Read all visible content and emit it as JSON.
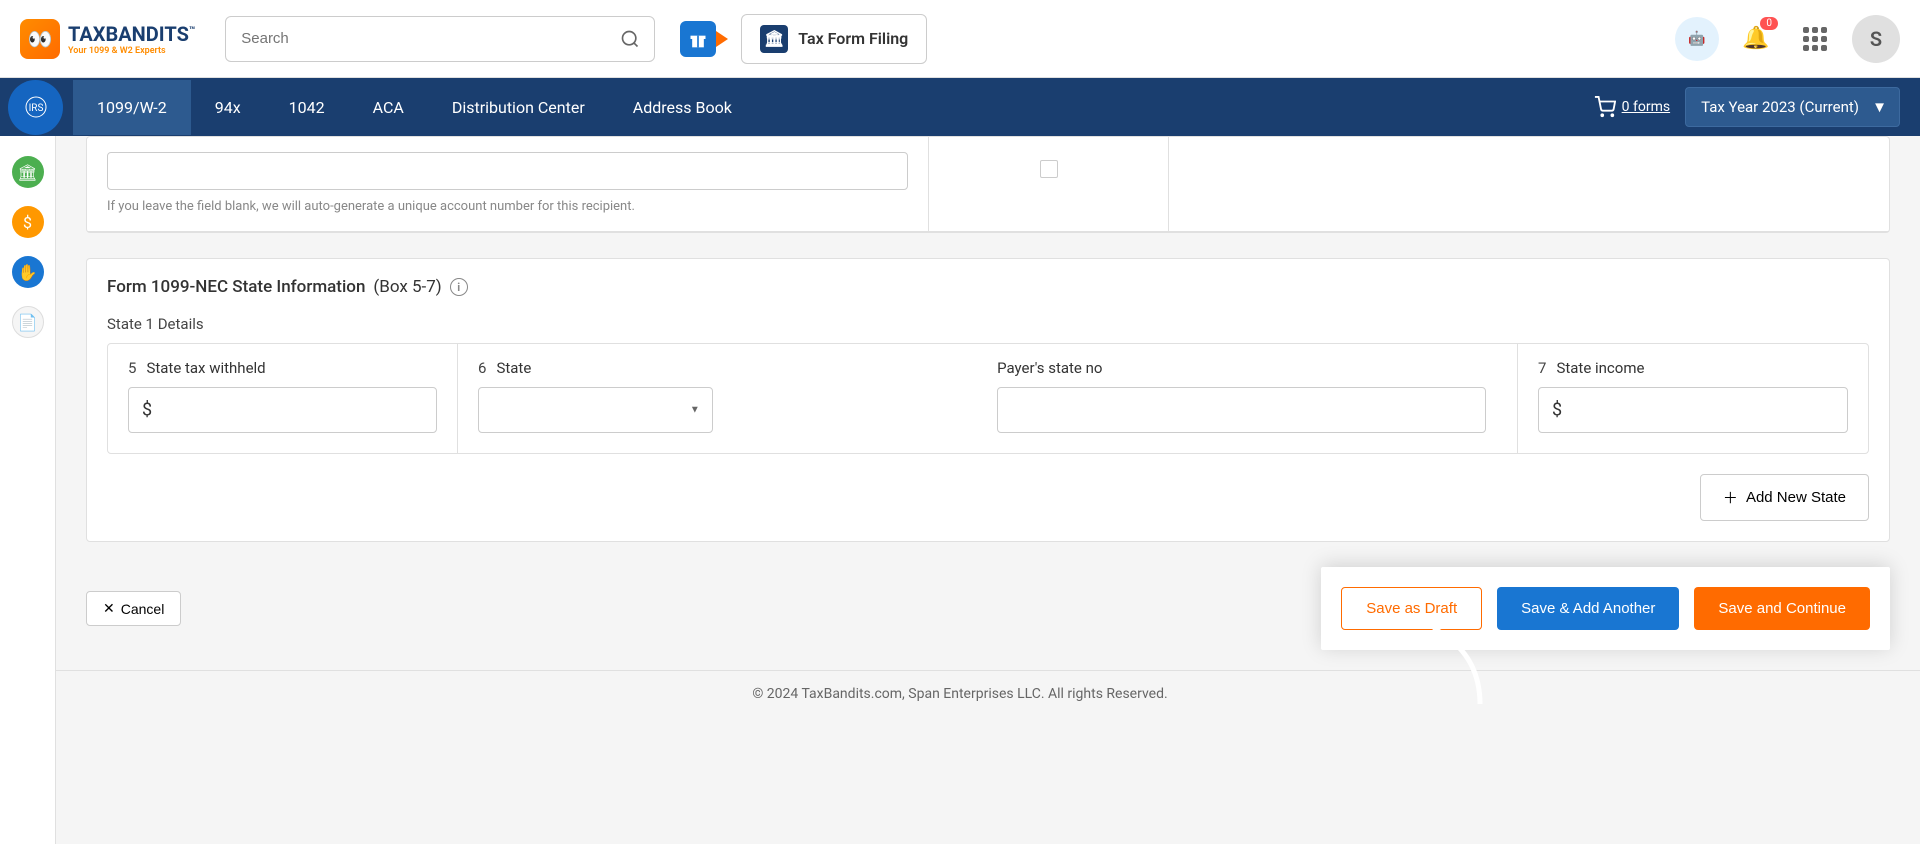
{
  "header": {
    "logo_text": "TAXBANDITS",
    "logo_subtitle": "Your 1099 & W2 Experts",
    "logo_sup": "™",
    "search_placeholder": "Search",
    "tax_filing_label": "Tax Form Filing",
    "notification_count": "0",
    "avatar_initial": "S"
  },
  "nav": {
    "tabs": [
      {
        "label": "1099/W-2"
      },
      {
        "label": "94x"
      },
      {
        "label": "1042"
      },
      {
        "label": "ACA"
      },
      {
        "label": "Distribution Center"
      },
      {
        "label": "Address Book"
      }
    ],
    "cart_label": "0 forms",
    "tax_year_label": "Tax Year 2023 (Current)"
  },
  "account": {
    "help_text": "If you leave the field blank, we will auto-generate a unique account number for this recipient."
  },
  "state_section": {
    "title": "Form 1099-NEC  State Information",
    "box_label": "(Box 5-7)",
    "subtitle": "State 1 Details",
    "field5_num": "5",
    "field5_label": "State tax withheld",
    "field6_num": "6",
    "field6_label": "State",
    "payer_label": "Payer's state no",
    "field7_num": "7",
    "field7_label": "State income",
    "add_state_label": "Add New State"
  },
  "buttons": {
    "cancel": "Cancel",
    "save_draft": "Save as Draft",
    "save_add": "Save & Add Another",
    "save_continue": "Save and Continue"
  },
  "footer": {
    "copyright": "© 2024 TaxBandits.com, Span Enterprises LLC. All rights Reserved."
  }
}
